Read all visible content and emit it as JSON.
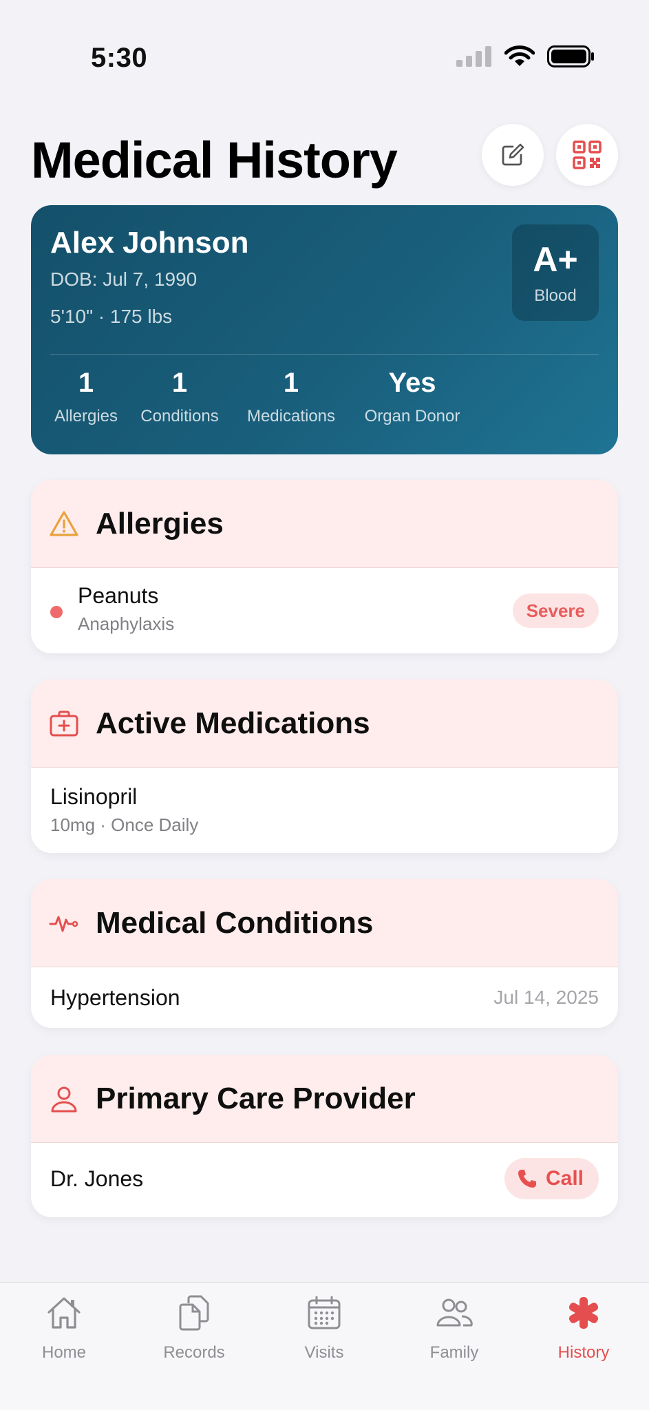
{
  "status_bar": {
    "time": "5:30"
  },
  "header": {
    "title": "Medical History",
    "edit_icon": "edit-icon",
    "qr_icon": "qr-code-icon"
  },
  "profile": {
    "name": "Alex Johnson",
    "dob": "DOB: Jul 7, 1990",
    "body": "5'10\" · 175 lbs",
    "blood_type": "A+",
    "blood_label": "Blood",
    "stats": [
      {
        "value": "1",
        "label": "Allergies"
      },
      {
        "value": "1",
        "label": "Conditions"
      },
      {
        "value": "1",
        "label": "Medications"
      },
      {
        "value": "Yes",
        "label": "Organ Donor"
      }
    ]
  },
  "allergies": {
    "title": "Allergies",
    "icon": "warning-icon",
    "items": [
      {
        "name": "Peanuts",
        "reaction": "Anaphylaxis",
        "severity": "Severe"
      }
    ]
  },
  "medications": {
    "title": "Active Medications",
    "icon": "medical-kit-icon",
    "items": [
      {
        "name": "Lisinopril",
        "detail": "10mg · Once Daily"
      }
    ]
  },
  "conditions": {
    "title": "Medical Conditions",
    "icon": "heartbeat-icon",
    "items": [
      {
        "name": "Hypertension",
        "date": "Jul 14, 2025"
      }
    ]
  },
  "provider": {
    "title": "Primary Care Provider",
    "icon": "person-icon",
    "name": "Dr. Jones",
    "call_label": "Call"
  },
  "tabs": [
    {
      "label": "Home",
      "icon": "home-icon"
    },
    {
      "label": "Records",
      "icon": "documents-icon"
    },
    {
      "label": "Visits",
      "icon": "calendar-icon"
    },
    {
      "label": "Family",
      "icon": "people-icon"
    },
    {
      "label": "History",
      "icon": "medical-asterisk-icon",
      "active": true
    }
  ],
  "colors": {
    "accent": "#e54e4e",
    "card_header": "#ffecec",
    "profile_card": "#195f7c"
  }
}
